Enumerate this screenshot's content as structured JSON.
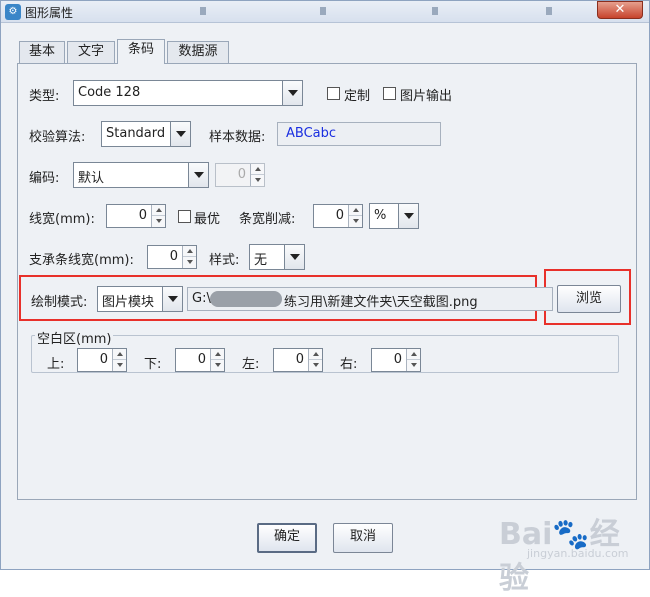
{
  "window": {
    "title": "图形属性",
    "close_glyph": "✕"
  },
  "tabs": [
    {
      "label": "基本"
    },
    {
      "label": "文字"
    },
    {
      "label": "条码"
    },
    {
      "label": "数据源"
    }
  ],
  "barcode": {
    "type_label": "类型:",
    "type_value": "Code 128",
    "custom_label": "定制",
    "image_output_label": "图片输出",
    "checksum_label": "校验算法:",
    "checksum_value": "Standard",
    "sample_label": "样本数据:",
    "sample_value": "ABCabc",
    "sample_color": "#1a2ee0",
    "encoding_label": "编码:",
    "encoding_value": "默认",
    "encoding_num": "0",
    "line_width_label": "线宽(mm):",
    "line_width_value": "0",
    "optimal_label": "最优",
    "bar_reduce_label": "条宽削减:",
    "bar_reduce_value": "0",
    "bar_reduce_unit": "%",
    "support_width_label": "支承条线宽(mm):",
    "support_width_value": "0",
    "style_label": "样式:",
    "style_value": "无",
    "draw_mode_label": "绘制模式:",
    "draw_mode_value": "图片模块",
    "path_prefix": "G:\\",
    "path_suffix": "练习用\\新建文件夹\\天空截图.png",
    "browse_label": "浏览"
  },
  "quiet_zone": {
    "title": "空白区(mm)",
    "top_label": "上:",
    "top_value": "0",
    "bottom_label": "下:",
    "bottom_value": "0",
    "left_label": "左:",
    "left_value": "0",
    "right_label": "右:",
    "right_value": "0"
  },
  "footer": {
    "ok_label": "确定",
    "cancel_label": "取消"
  },
  "watermark": {
    "text": "Bai🐾经验",
    "sub": "jingyan.baidu.com"
  },
  "colors": {
    "highlight": "#e8302a"
  }
}
